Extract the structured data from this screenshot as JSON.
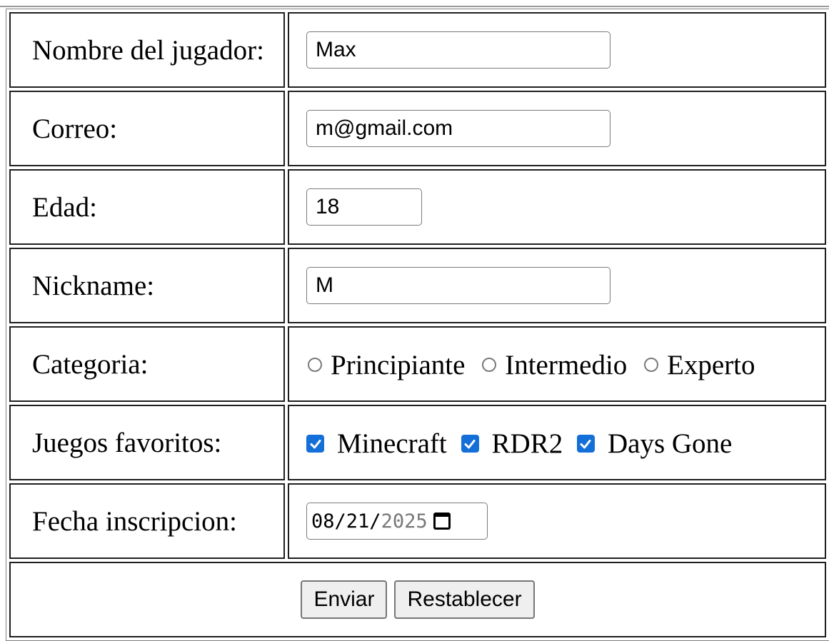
{
  "form": {
    "player_name": {
      "label": "Nombre del jugador:",
      "value": "Max"
    },
    "email": {
      "label": "Correo:",
      "value": "m@gmail.com"
    },
    "age": {
      "label": "Edad:",
      "value": "18"
    },
    "nickname": {
      "label": "Nickname:",
      "value": "M"
    },
    "category": {
      "label": "Categoria:",
      "options": [
        "Principiante",
        "Intermedio",
        "Experto"
      ]
    },
    "favorite_games": {
      "label": "Juegos favoritos:",
      "options": [
        "Minecraft",
        "RDR2",
        "Days Gone"
      ],
      "checked": [
        true,
        true,
        true
      ]
    },
    "signup_date": {
      "label": "Fecha inscripcion:",
      "month": "08",
      "day": "21",
      "year": "2025"
    },
    "buttons": {
      "submit": "Enviar",
      "reset": "Restablecer"
    }
  },
  "colors": {
    "checkbox": "#1470d8",
    "date_year_text": "#777777"
  },
  "icons": {
    "date_picker": "calendar-icon",
    "check": "checkmark-icon"
  }
}
